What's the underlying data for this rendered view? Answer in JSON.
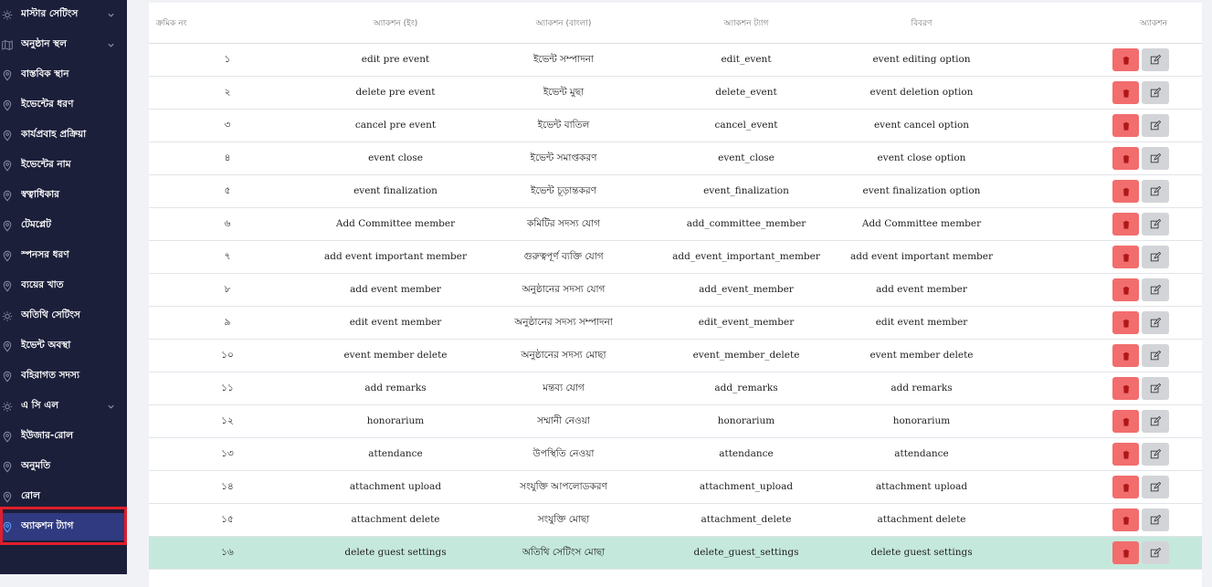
{
  "colors": {
    "sidebar_bg": "#1b1f3a",
    "sidebar_active_bg": "#303a80",
    "active_outline": "#e01e2b",
    "delete_button": "#f26d6d",
    "edit_button": "#d2d4d8",
    "highlight_row": "#c5e8dd"
  },
  "sidebar": {
    "items": [
      {
        "label": "মাস্টার সেটিংস",
        "icon": "gear-icon",
        "expandable": true
      },
      {
        "label": "অনুষ্ঠান স্থল",
        "icon": "map-icon",
        "expandable": true
      },
      {
        "label": "বাস্তবিক স্থান",
        "icon": "location-pin-icon"
      },
      {
        "label": "ইভেন্টের ধরণ",
        "icon": "location-pin-icon"
      },
      {
        "label": "কার্যপ্রবাহ প্রক্রিয়া",
        "icon": "location-pin-icon"
      },
      {
        "label": "ইভেন্টের নাম",
        "icon": "location-pin-icon"
      },
      {
        "label": "স্বত্বাধিকার",
        "icon": "location-pin-icon"
      },
      {
        "label": "টেমপ্লেট",
        "icon": "location-pin-icon"
      },
      {
        "label": "স্পনসর ধরণ",
        "icon": "location-pin-icon"
      },
      {
        "label": "ব্যয়ের খাত",
        "icon": "location-pin-icon"
      },
      {
        "label": "অতিথি সেটিংস",
        "icon": "gear-icon"
      },
      {
        "label": "ইভেন্ট অবস্থা",
        "icon": "location-pin-icon"
      },
      {
        "label": "বহিরাগত সদস্য",
        "icon": "location-pin-icon"
      },
      {
        "label": "এ সি এল",
        "icon": "gear-icon",
        "expandable": true
      },
      {
        "label": "ইউজার-রোল",
        "icon": "location-pin-icon"
      },
      {
        "label": "অনুমতি",
        "icon": "location-pin-icon"
      },
      {
        "label": "রোল",
        "icon": "location-pin-icon"
      },
      {
        "label": "অ্যাকশন ট্যাগ",
        "icon": "location-pin-icon",
        "active": true
      }
    ]
  },
  "table": {
    "headers": {
      "serial": "ক্রমিক নং",
      "action_en": "অ্যাকশন (ইং)",
      "action_bn": "অ্যাকশন (বাংলা)",
      "action_tag": "অ্যাকশন ট্যাগ",
      "description": "বিবরণ",
      "actions": "অ্যাকশন"
    },
    "rows": [
      {
        "serial": "১",
        "action_en": "edit pre event",
        "action_bn": "ইভেন্ট সম্পাদনা",
        "tag": "edit_event",
        "description": "event editing option"
      },
      {
        "serial": "২",
        "action_en": "delete pre event",
        "action_bn": "ইভেন্ট মুছা",
        "tag": "delete_event",
        "description": "event deletion option"
      },
      {
        "serial": "৩",
        "action_en": "cancel pre event",
        "action_bn": "ইভেন্ট বাতিল",
        "tag": "cancel_event",
        "description": "event cancel option"
      },
      {
        "serial": "৪",
        "action_en": "event close",
        "action_bn": "ইভেন্ট সমাপ্তকরণ",
        "tag": "event_close",
        "description": "event close option"
      },
      {
        "serial": "৫",
        "action_en": "event finalization",
        "action_bn": "ইভেন্ট চূড়ান্তকরণ",
        "tag": "event_finalization",
        "description": "event finalization option"
      },
      {
        "serial": "৬",
        "action_en": "Add Committee member",
        "action_bn": "কমিটির সদস্য যোগ",
        "tag": "add_committee_member",
        "description": "Add Committee member"
      },
      {
        "serial": "৭",
        "action_en": "add event important member",
        "action_bn": "গুরুত্বপূর্ণ ব্যক্তি যোগ",
        "tag": "add_event_important_member",
        "description": "add event important member"
      },
      {
        "serial": "৮",
        "action_en": "add event member",
        "action_bn": "অনুষ্ঠানের সদস্য যোগ",
        "tag": "add_event_member",
        "description": "add event member"
      },
      {
        "serial": "৯",
        "action_en": "edit event member",
        "action_bn": "অনুষ্ঠানের সদস্য সম্পাদনা",
        "tag": "edit_event_member",
        "description": "edit event member"
      },
      {
        "serial": "১০",
        "action_en": "event member delete",
        "action_bn": "অনুষ্ঠানের সদস্য মোছা",
        "tag": "event_member_delete",
        "description": "event member delete"
      },
      {
        "serial": "১১",
        "action_en": "add remarks",
        "action_bn": "মন্তব্য যোগ",
        "tag": "add_remarks",
        "description": "add remarks"
      },
      {
        "serial": "১২",
        "action_en": "honorarium",
        "action_bn": "সম্মানী নেওয়া",
        "tag": "honorarium",
        "description": "honorarium"
      },
      {
        "serial": "১৩",
        "action_en": "attendance",
        "action_bn": "উপস্থিতি নেওয়া",
        "tag": "attendance",
        "description": "attendance"
      },
      {
        "serial": "১৪",
        "action_en": "attachment upload",
        "action_bn": "সংযুক্তি আপলোডকরণ",
        "tag": "attachment_upload",
        "description": "attachment upload"
      },
      {
        "serial": "১৫",
        "action_en": "attachment delete",
        "action_bn": "সংযুক্তি মোছা",
        "tag": "attachment_delete",
        "description": "attachment delete"
      },
      {
        "serial": "১৬",
        "action_en": "delete guest settings",
        "action_bn": "অতিথি সেটিংস মোছা",
        "tag": "delete_guest_settings",
        "description": "delete guest settings",
        "highlighted": true
      }
    ]
  }
}
